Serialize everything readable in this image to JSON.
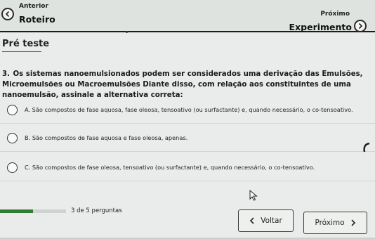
{
  "nav": {
    "prev_small": "Anterior",
    "prev_big": "Roteiro",
    "next_small": "Próximo",
    "next_big": "Experimento"
  },
  "section": {
    "title": "Pré teste"
  },
  "question": {
    "number": "3.",
    "text": "Os sistemas nanoemulsionados podem ser considerados uma derivação das Emulsões, Microemulsões ou Macroemulsões Diante disso, com relação aos constituintes de uma nanoemulsão, assinale a alternativa correta:"
  },
  "options": [
    {
      "label": "A. São compostos de fase aquosa, fase oleosa, tensoativo (ou surfactante) e, quando necessário, o co-tensoativo."
    },
    {
      "label": "B. São compostos de fase aquosa e fase oleosa, apenas."
    },
    {
      "label": "C. São compostos de fase oleosa, tensoativo (ou surfactante) e, quando necessário, o co-tensoativo."
    }
  ],
  "progress": {
    "text": "3 de 5 perguntas",
    "fraction": 0.5
  },
  "buttons": {
    "back": "Voltar",
    "next": "Próximo"
  },
  "colors": {
    "accent": "#2e7d32",
    "background": "#e9ecea"
  },
  "icons": {
    "prev": "chevron-left-circle-icon",
    "next": "chevron-right-circle-icon"
  }
}
